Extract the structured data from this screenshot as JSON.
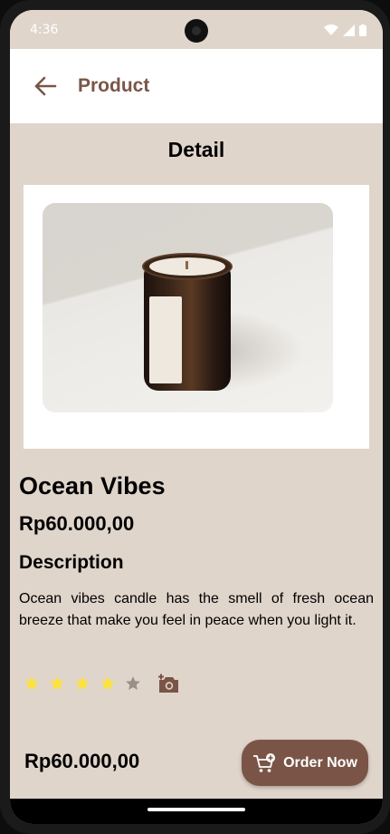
{
  "status_bar": {
    "time": "4:36",
    "icons": [
      "wifi-icon",
      "signal-icon",
      "battery-icon"
    ]
  },
  "app_bar": {
    "back_icon": "arrow-left-icon",
    "title": "Product"
  },
  "section": {
    "title": "Detail"
  },
  "product": {
    "name": "Ocean Vibes",
    "price": "Rp60.000,00",
    "description_title": "Description",
    "description": "Ocean vibes candle has the smell of fresh ocean breeze that make you feel in peace when you light it.",
    "rating": 4,
    "rating_max": 5
  },
  "footer": {
    "price": "Rp60.000,00",
    "order_button_label": "Order Now",
    "order_icon": "add-to-cart-icon"
  },
  "colors": {
    "accent": "#7a5547",
    "background": "#e0d5cb",
    "star_filled": "#fde23b",
    "star_empty": "#9b9089"
  }
}
